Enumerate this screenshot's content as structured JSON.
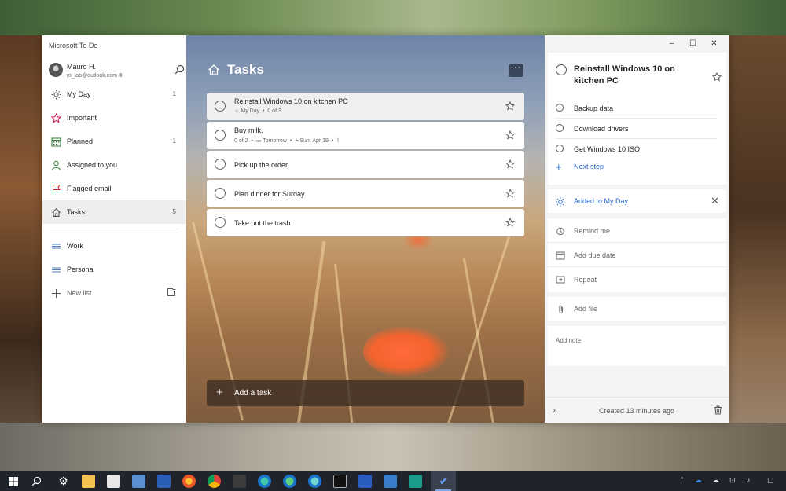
{
  "app": {
    "title": "Microsoft To Do"
  },
  "profile": {
    "name": "Mauro H.",
    "email": "m_lab@outlook.com"
  },
  "nav": {
    "items": [
      {
        "label": "My Day",
        "count": "1",
        "icon": "sun-icon"
      },
      {
        "label": "Important",
        "count": "",
        "icon": "star-icon"
      },
      {
        "label": "Planned",
        "count": "1",
        "icon": "calendar-icon"
      },
      {
        "label": "Assigned to you",
        "count": "",
        "icon": "person-icon"
      },
      {
        "label": "Flagged email",
        "count": "",
        "icon": "flag-icon"
      },
      {
        "label": "Tasks",
        "count": "5",
        "icon": "home-icon"
      }
    ],
    "lists": [
      {
        "label": "Work",
        "icon": "list-icon"
      },
      {
        "label": "Personal",
        "icon": "list-icon"
      }
    ],
    "new_list": "New list"
  },
  "main": {
    "title": "Tasks",
    "more_label": "···",
    "tasks": [
      {
        "title": "Reinstall Windows 10 on kitchen PC",
        "meta1": "My Day",
        "meta2": "0 of 3",
        "meta3": "",
        "meta4": ""
      },
      {
        "title": "Buy milk.",
        "meta1": "0 of 2",
        "meta2": "Tomorrow",
        "meta3": "Sun, Apr 19",
        "meta4": ""
      },
      {
        "title": "Pick up the order",
        "meta1": "",
        "meta2": "",
        "meta3": "",
        "meta4": ""
      },
      {
        "title": "Plan dinner for Surday",
        "meta1": "",
        "meta2": "",
        "meta3": "",
        "meta4": ""
      },
      {
        "title": "Take out the trash",
        "meta1": "",
        "meta2": "",
        "meta3": "",
        "meta4": ""
      }
    ],
    "add_task": "Add a task"
  },
  "detail": {
    "title": "Reinstall Windows 10 on kitchen PC",
    "steps": [
      "Backup data",
      "Download drivers",
      "Get Windows 10 ISO"
    ],
    "next_step": "Next step",
    "my_day": "Added to My Day",
    "remind": "Remind me",
    "due": "Add due date",
    "repeat": "Repeat",
    "add_file": "Add file",
    "add_note": "Add note",
    "created": "Created 13 minutes ago"
  },
  "colors": {
    "accent": "#2564cf",
    "taskbar": "#1f232b"
  }
}
